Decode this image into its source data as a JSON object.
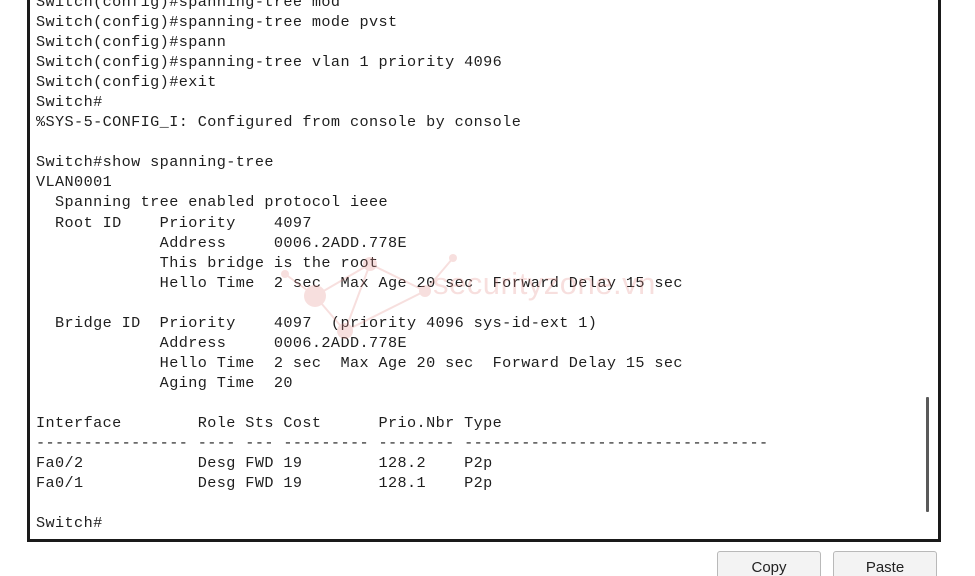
{
  "terminal": {
    "lines": [
      "Switch(config)#spanning-tree mod",
      "Switch(config)#spanning-tree mode pvst",
      "Switch(config)#spann",
      "Switch(config)#spanning-tree vlan 1 priority 4096",
      "Switch(config)#exit",
      "Switch#",
      "%SYS-5-CONFIG_I: Configured from console by console",
      "",
      "Switch#show spanning-tree",
      "VLAN0001",
      "  Spanning tree enabled protocol ieee",
      "  Root ID    Priority    4097",
      "             Address     0006.2ADD.778E",
      "             This bridge is the root",
      "             Hello Time  2 sec  Max Age 20 sec  Forward Delay 15 sec",
      "",
      "  Bridge ID  Priority    4097  (priority 4096 sys-id-ext 1)",
      "             Address     0006.2ADD.778E",
      "             Hello Time  2 sec  Max Age 20 sec  Forward Delay 15 sec",
      "             Aging Time  20",
      "",
      "Interface        Role Sts Cost      Prio.Nbr Type",
      "---------------- ---- --- --------- -------- --------------------------------",
      "Fa0/2            Desg FWD 19        128.2    P2p",
      "Fa0/1            Desg FWD 19        128.1    P2p",
      "",
      "Switch#"
    ]
  },
  "watermark": {
    "text": "securityzone.vn"
  },
  "buttons": {
    "copy_label": "Copy",
    "paste_label": "Paste"
  }
}
